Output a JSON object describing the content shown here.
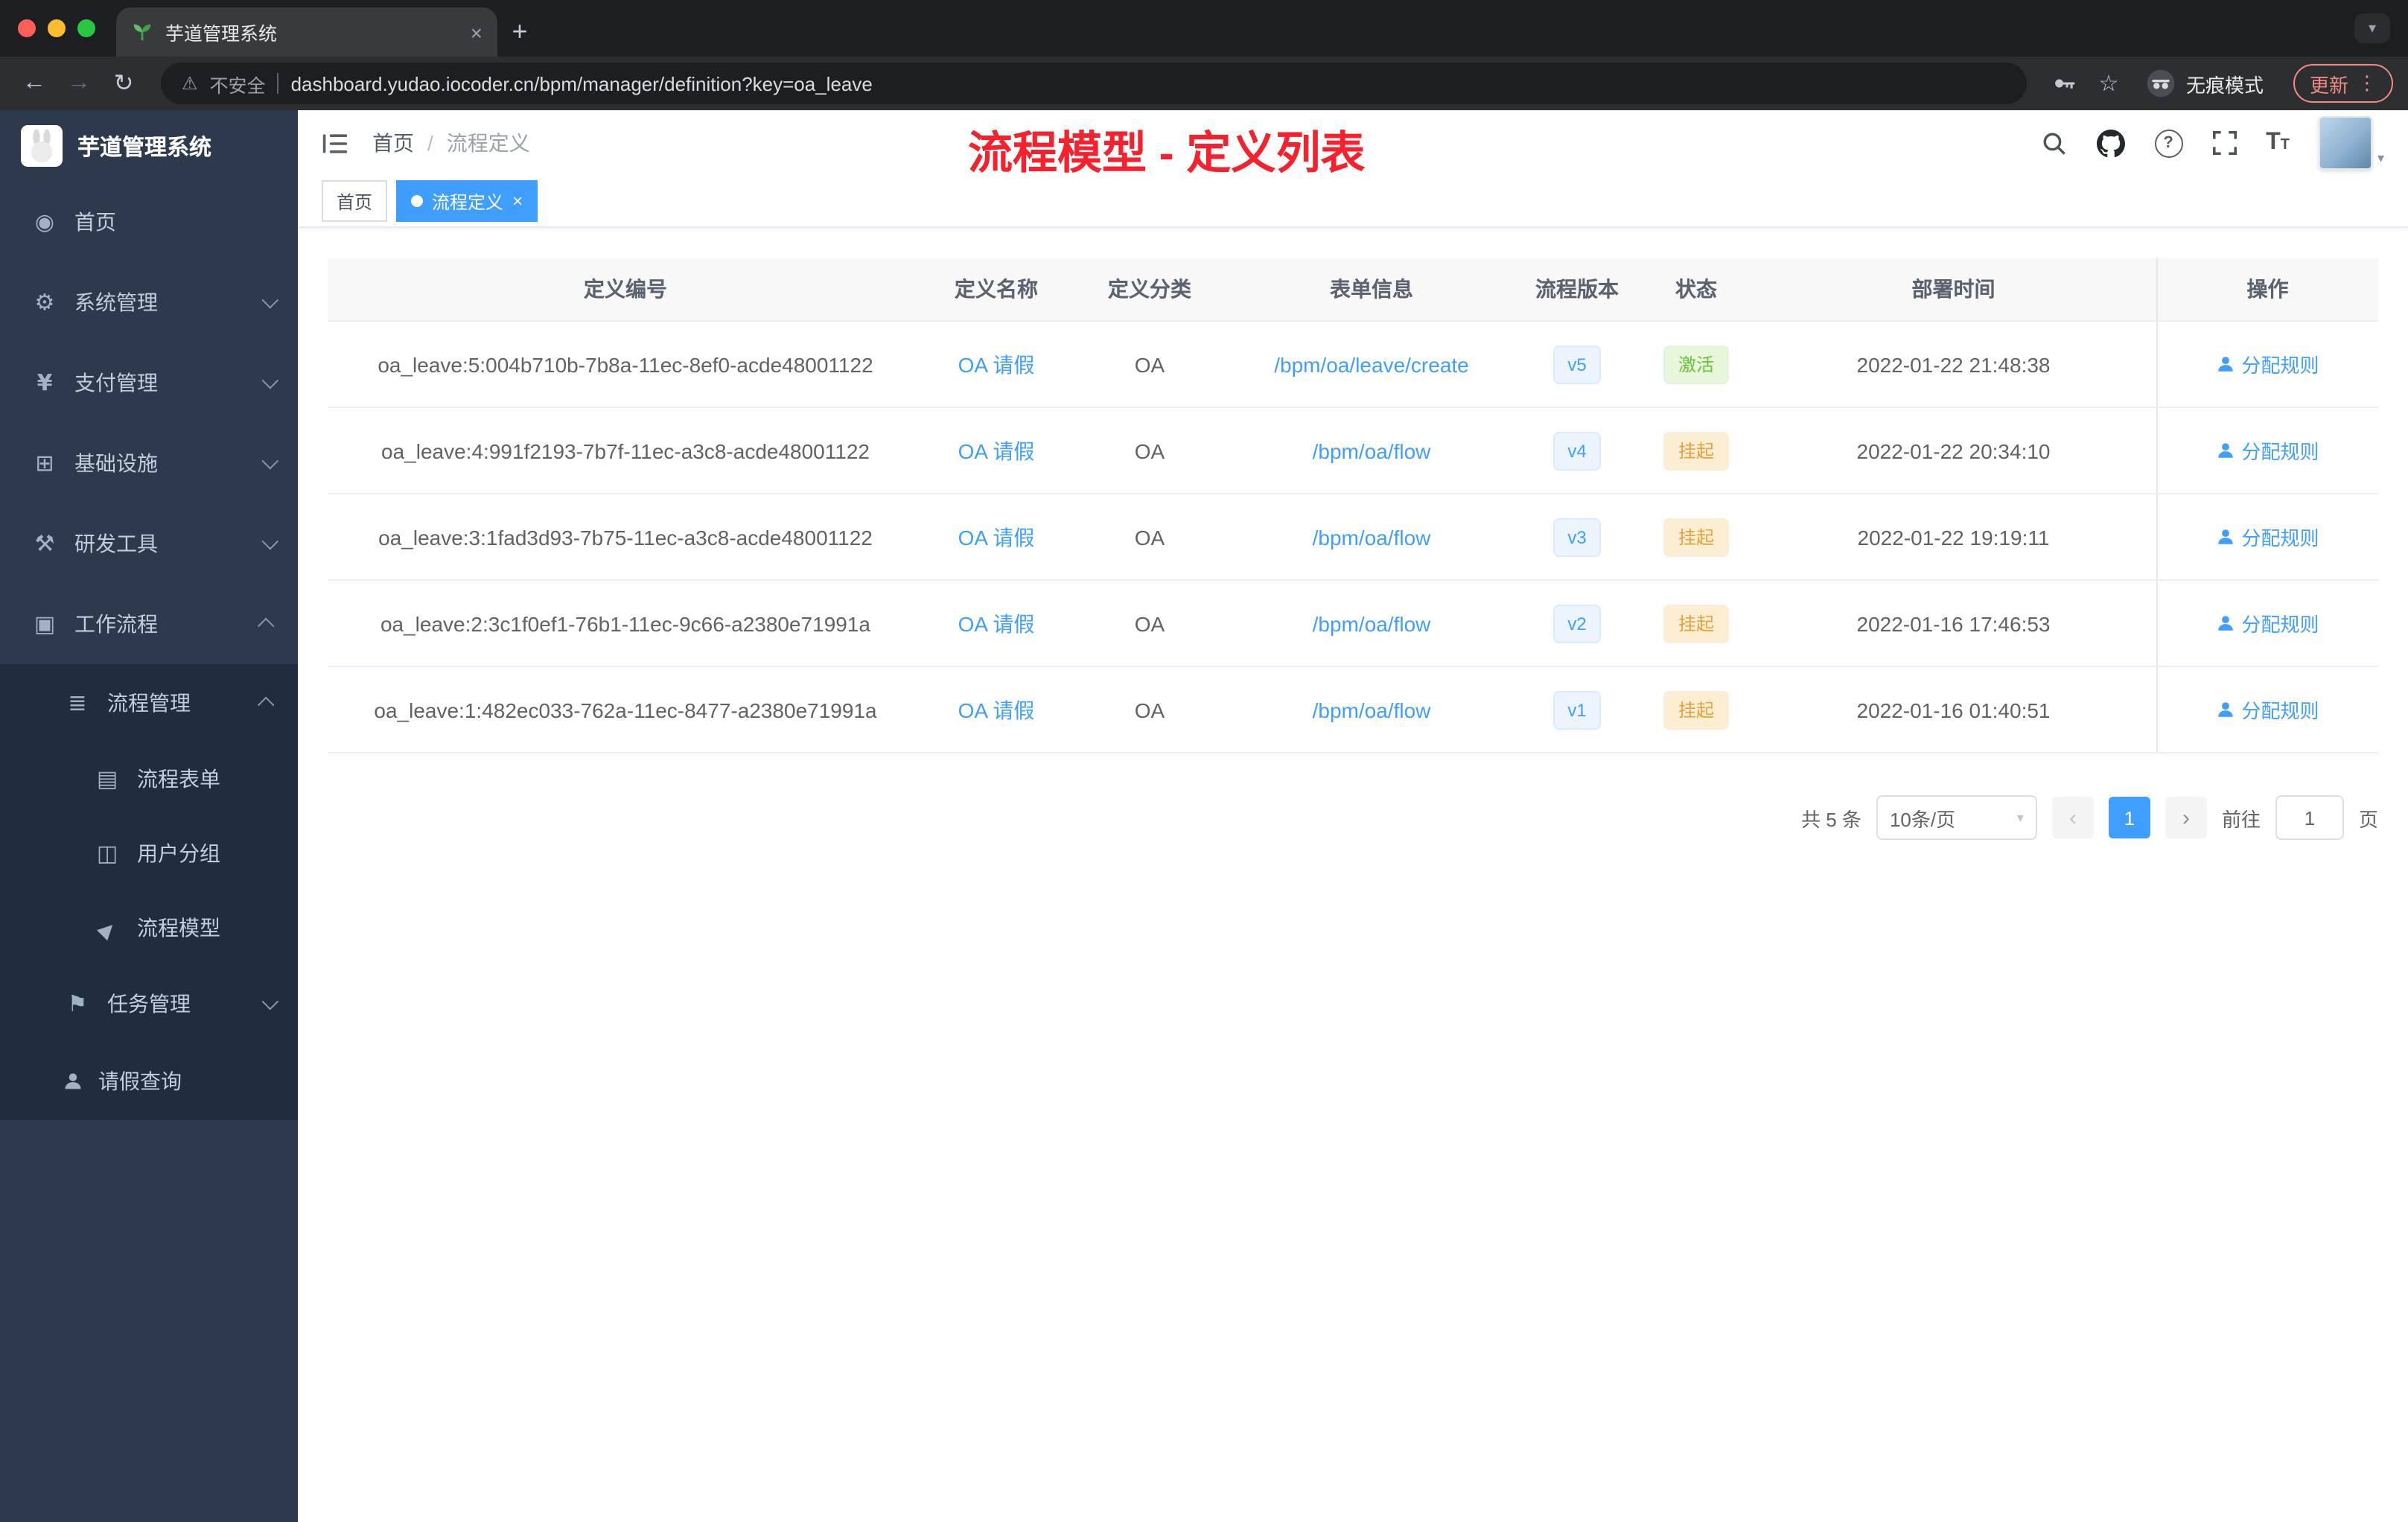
{
  "browser": {
    "tab_title": "芋道管理系统",
    "security_label": "不安全",
    "url": "dashboard.yudao.iocoder.cn/bpm/manager/definition?key=oa_leave",
    "incognito_label": "无痕模式",
    "update_label": "更新"
  },
  "sidebar": {
    "app_title": "芋道管理系统",
    "items": [
      {
        "label": "首页",
        "icon": "dashboard"
      },
      {
        "label": "系统管理",
        "icon": "gear"
      },
      {
        "label": "支付管理",
        "icon": "yen"
      },
      {
        "label": "基础设施",
        "icon": "infrastructure"
      },
      {
        "label": "研发工具",
        "icon": "tools"
      },
      {
        "label": "工作流程",
        "icon": "workflow"
      },
      {
        "label": "流程管理",
        "icon": "process-list"
      },
      {
        "label": "流程表单",
        "icon": "form"
      },
      {
        "label": "用户分组",
        "icon": "user-group"
      },
      {
        "label": "流程模型",
        "icon": "paper-plane"
      },
      {
        "label": "任务管理",
        "icon": "task-flag"
      },
      {
        "label": "请假查询",
        "icon": "person"
      }
    ]
  },
  "header": {
    "breadcrumb": [
      "首页",
      "流程定义"
    ],
    "separator": "/",
    "annotation": "流程模型 - 定义列表"
  },
  "tags": [
    {
      "label": "首页",
      "active": false
    },
    {
      "label": "流程定义",
      "active": true
    }
  ],
  "table": {
    "columns": [
      "定义编号",
      "定义名称",
      "定义分类",
      "表单信息",
      "流程版本",
      "状态",
      "部署时间",
      "操作"
    ],
    "rows": [
      {
        "id": "oa_leave:5:004b710b-7b8a-11ec-8ef0-acde48001122",
        "name": "OA 请假",
        "category": "OA",
        "form": "/bpm/oa/leave/create",
        "version": "v5",
        "status": "激活",
        "time": "2022-01-22 21:48:38",
        "action": "分配规则"
      },
      {
        "id": "oa_leave:4:991f2193-7b7f-11ec-a3c8-acde48001122",
        "name": "OA 请假",
        "category": "OA",
        "form": "/bpm/oa/flow",
        "version": "v4",
        "status": "挂起",
        "time": "2022-01-22 20:34:10",
        "action": "分配规则"
      },
      {
        "id": "oa_leave:3:1fad3d93-7b75-11ec-a3c8-acde48001122",
        "name": "OA 请假",
        "category": "OA",
        "form": "/bpm/oa/flow",
        "version": "v3",
        "status": "挂起",
        "time": "2022-01-22 19:19:11",
        "action": "分配规则"
      },
      {
        "id": "oa_leave:2:3c1f0ef1-76b1-11ec-9c66-a2380e71991a",
        "name": "OA 请假",
        "category": "OA",
        "form": "/bpm/oa/flow",
        "version": "v2",
        "status": "挂起",
        "time": "2022-01-16 17:46:53",
        "action": "分配规则"
      },
      {
        "id": "oa_leave:1:482ec033-762a-11ec-8477-a2380e71991a",
        "name": "OA 请假",
        "category": "OA",
        "form": "/bpm/oa/flow",
        "version": "v1",
        "status": "挂起",
        "time": "2022-01-16 01:40:51",
        "action": "分配规则"
      }
    ]
  },
  "pagination": {
    "total": "共 5 条",
    "page_size": "10条/页",
    "current_page": "1",
    "goto_label": "前往",
    "goto_value": "1",
    "page_unit": "页"
  },
  "colors": {
    "accent": "#409eff",
    "success": "#67c23a",
    "warning": "#e6a23c",
    "annotation_red": "#f5222d",
    "sidebar_bg": "#2d3a4d"
  }
}
